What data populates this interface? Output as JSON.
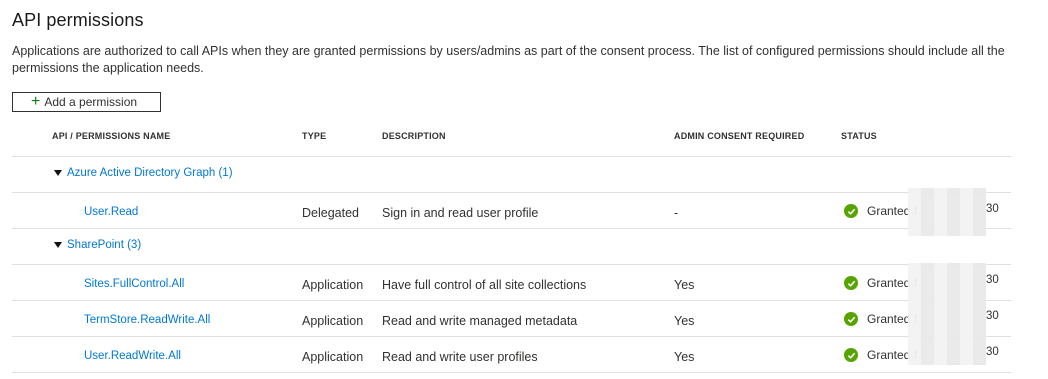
{
  "page": {
    "title": "API permissions",
    "intro": "Applications are authorized to call APIs when they are granted permissions by users/admins as part of the consent process. The list of configured permissions should include all the permissions the application needs.",
    "add_button_label": "Add a permission",
    "add_button_icon": "plus-icon"
  },
  "table": {
    "columns": [
      "API / PERMISSIONS NAME",
      "TYPE",
      "DESCRIPTION",
      "ADMIN CONSENT REQUIRED",
      "STATUS"
    ],
    "groups": [
      {
        "label": "Azure Active Directory Graph (1)",
        "rows": [
          {
            "name": "User.Read",
            "type": "Delegated",
            "description": "Sign in and read user profile",
            "admin": "-",
            "status": "Granted f",
            "status_tail": "30"
          }
        ]
      },
      {
        "label": "SharePoint (3)",
        "rows": [
          {
            "name": "Sites.FullControl.All",
            "type": "Application",
            "description": "Have full control of all site collections",
            "admin": "Yes",
            "status": "Granted f",
            "status_tail": "30"
          },
          {
            "name": "TermStore.ReadWrite.All",
            "type": "Application",
            "description": "Read and write managed metadata",
            "admin": "Yes",
            "status": "Granted f",
            "status_tail": "30"
          },
          {
            "name": "User.ReadWrite.All",
            "type": "Application",
            "description": "Read and write user profiles",
            "admin": "Yes",
            "status": "Granted f",
            "status_tail": "30"
          }
        ]
      }
    ]
  },
  "colors": {
    "link": "#0078d4",
    "granted": "#57a300",
    "add_plus": "#107c10"
  }
}
